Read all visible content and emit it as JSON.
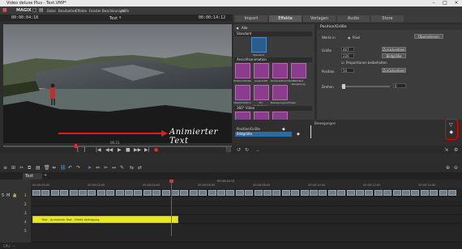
{
  "window": {
    "title": "Video deluxe Plus - Text.VMP*",
    "controls": [
      "–",
      "□",
      "×"
    ]
  },
  "menubar": {
    "logo": "MAGIX",
    "items": [
      "Datei",
      "Bearbeiten",
      "Effekte",
      "Fenster",
      "Beschleuniger",
      "Hilfe"
    ]
  },
  "preview": {
    "timecode_left": "00:00:04:18",
    "project_name": "Text",
    "timecode_right": "00:00:14:12",
    "overlay_text": "Animierter Text",
    "scrub_time": "06:21"
  },
  "tabs": [
    {
      "label": "Import",
      "active": false
    },
    {
      "label": "Effekte",
      "active": true
    },
    {
      "label": "Vorlagen",
      "active": false
    },
    {
      "label": "Audio",
      "active": false
    },
    {
      "label": "Store",
      "active": false
    }
  ],
  "effects": {
    "filter_label": "Alle",
    "section_standard": "Standard",
    "section_animation": "Ansichtsanimation",
    "section_360": "360° Video",
    "tile_selected": "Standard",
    "tiles_row1": [
      "Position/Größe",
      "Ausschnitt",
      "Kamera/Zoomfahrt",
      "Bild-Text Spiegelung"
    ],
    "tiles_row2": [
      "Objektrotation",
      "3D-Verformung",
      "Bewegungsverfolger"
    ],
    "colors": {
      "tile_fill": "#8c3c8c",
      "tile_selected": "#2a5d8c"
    }
  },
  "properties": {
    "title": "Position/Größe",
    "rows": [
      {
        "label": "Werte in",
        "value": "Pixel"
      },
      {
        "label": "Größe",
        "value": "467"
      },
      {
        "label": "",
        "value": "226"
      },
      {
        "label": "Position",
        "value": "50"
      },
      {
        "label": "Drehen",
        "value": "0"
      }
    ],
    "buttons": [
      "Übernehmen",
      "Zurücksetzen",
      "Bildgröße",
      "Zurücksetzen"
    ],
    "checkbox_label": "Proportionen beibehalten"
  },
  "keyframes": {
    "header": "Bewegungen",
    "track1": "Position/Größe",
    "track2": "Bildgröße"
  },
  "timeline": {
    "tab_label": "Text",
    "ruler_marks": [
      "00:00:00:00",
      "00:00:02:00",
      "00:00:04:00",
      "00:00:06:00",
      "00:00:08:00",
      "00:00:10:00",
      "00:00:12:00",
      "00:00:14:00"
    ],
    "ruler_top_label": "00:00:14:12",
    "title_clip_label": "Titel - Animierter Text - Effekt Verfolgung",
    "track_numbers": [
      "1",
      "2",
      "3",
      "4",
      "5"
    ],
    "colors": {
      "title_clip": "#e8e820",
      "playhead": "#e03030"
    }
  },
  "status": {
    "text": "CPU: —"
  }
}
